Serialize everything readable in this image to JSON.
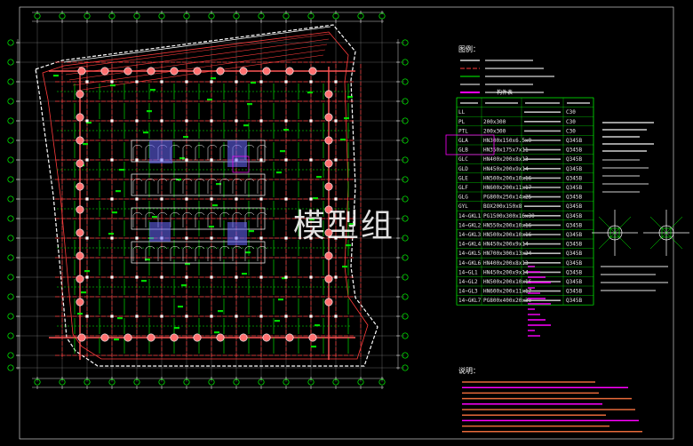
{
  "watermark": "模型组",
  "legend": {
    "title": "图例：",
    "items": []
  },
  "member_table": {
    "title": "构件表",
    "rows": [
      {
        "code": "LL",
        "spec": "",
        "note": "",
        "grade": "C30"
      },
      {
        "code": "PL",
        "spec": "200x300",
        "note": "",
        "grade": "C30"
      },
      {
        "code": "PTL",
        "spec": "200x300",
        "note": "",
        "grade": "C30"
      },
      {
        "code": "GLA",
        "spec": "HN300x150x6.5x9",
        "note": "",
        "grade": "Q345B"
      },
      {
        "code": "GLB",
        "spec": "HN350x175x7x11",
        "note": "",
        "grade": "Q345B"
      },
      {
        "code": "GLC",
        "spec": "HN400x200x8x13",
        "note": "",
        "grade": "Q345B"
      },
      {
        "code": "GLD",
        "spec": "HN450x200x9x14",
        "note": "",
        "grade": "Q345B"
      },
      {
        "code": "GLE",
        "spec": "HN500x200x10x16",
        "note": "",
        "grade": "Q345B"
      },
      {
        "code": "GLF",
        "spec": "HN600x200x11x17",
        "note": "",
        "grade": "Q345B"
      },
      {
        "code": "GLG",
        "spec": "PG800x250x14x25",
        "note": "",
        "grade": "Q345B"
      },
      {
        "code": "GYL",
        "spec": "BOX200x150x8",
        "note": "",
        "grade": "Q345B"
      },
      {
        "code": "14~GKL1",
        "spec": "PG1500x300x16x30",
        "note": "",
        "grade": "Q345B"
      },
      {
        "code": "14~GKL2",
        "spec": "HN550x200x10x16",
        "note": "",
        "grade": "Q345B"
      },
      {
        "code": "14~GKL3",
        "spec": "HN500x200x10x16",
        "note": "",
        "grade": "Q345B"
      },
      {
        "code": "14~GKL4",
        "spec": "HN450x200x9x14",
        "note": "",
        "grade": "Q345B"
      },
      {
        "code": "14~GKL5",
        "spec": "HN700x300x13x24",
        "note": "",
        "grade": "Q345B"
      },
      {
        "code": "14~GKL6",
        "spec": "HN400x200x8x13",
        "note": "",
        "grade": "Q345B"
      },
      {
        "code": "14~GL1",
        "spec": "HN450x200x9x14",
        "note": "",
        "grade": "Q345B"
      },
      {
        "code": "14~GL2",
        "spec": "HN500x200x10x16",
        "note": "",
        "grade": "Q345B"
      },
      {
        "code": "14~GL3",
        "spec": "HN600x200x11x17",
        "note": "",
        "grade": "Q345B"
      },
      {
        "code": "14~GKL7",
        "spec": "PG800x400x20x30",
        "note": "",
        "grade": "Q345B"
      }
    ]
  },
  "notes": {
    "title": "说明："
  },
  "colors": {
    "background": "#000000",
    "axis": "#00ff00",
    "beam": "#ff3b3b",
    "dim": "#ffffff",
    "text": "#ffffff",
    "accent": "#ff00ff",
    "blue": "#6a6aff"
  }
}
